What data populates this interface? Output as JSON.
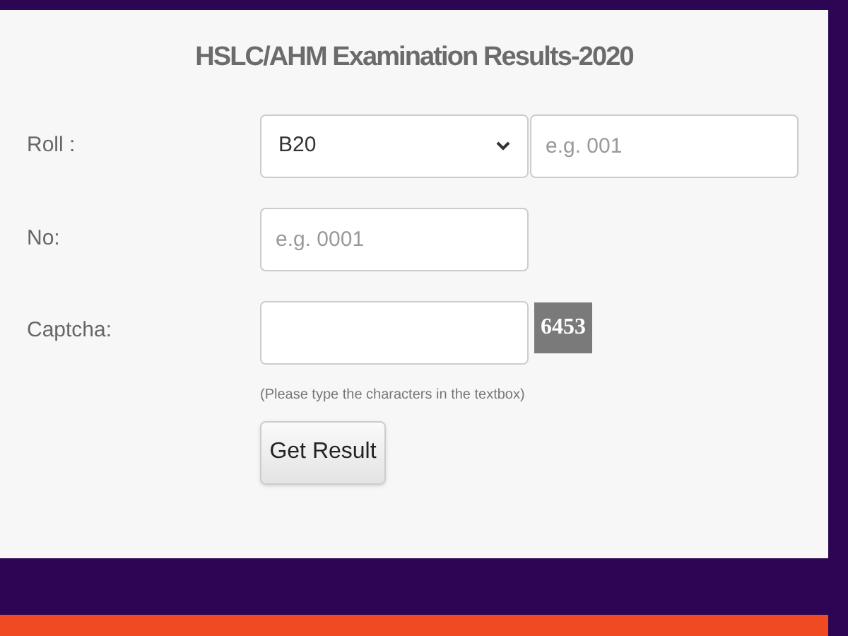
{
  "title": "HSLC/AHM Examination Results-2020",
  "form": {
    "roll_label": "Roll :",
    "roll_prefix": {
      "value": "B20"
    },
    "roll_code": {
      "placeholder": "e.g. 001"
    },
    "no_label": "No:",
    "no_field": {
      "placeholder": "e.g. 0001"
    },
    "captcha_label": "Captcha:",
    "captcha_code": "6453",
    "captcha_hint": "(Please type the characters in the textbox)",
    "submit": "Get Result"
  }
}
